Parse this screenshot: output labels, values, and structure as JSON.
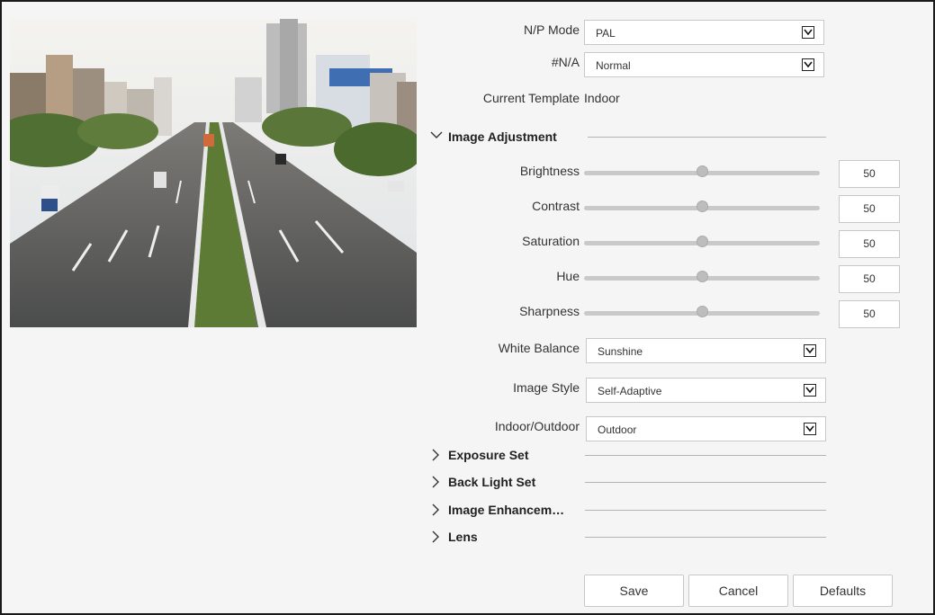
{
  "np_mode": {
    "label": "N/P Mode",
    "value": "PAL"
  },
  "na_mode": {
    "label": "#N/A",
    "value": "Normal"
  },
  "current_template": {
    "label": "Current Template",
    "value": "Indoor"
  },
  "sections": {
    "image_adjustment": "Image Adjustment",
    "exposure_set": "Exposure Set",
    "back_light_set": "Back Light Set",
    "image_enhancement": "Image Enhancem…",
    "lens": "Lens"
  },
  "sliders": [
    {
      "label": "Brightness",
      "value": "50",
      "level": 50
    },
    {
      "label": "Contrast",
      "value": "50",
      "level": 50
    },
    {
      "label": "Saturation",
      "value": "50",
      "level": 50
    },
    {
      "label": "Hue",
      "value": "50",
      "level": 50
    },
    {
      "label": "Sharpness",
      "value": "50",
      "level": 50
    }
  ],
  "white_balance": {
    "label": "White Balance",
    "value": "Sunshine"
  },
  "image_style": {
    "label": "Image Style",
    "value": "Self-Adaptive"
  },
  "indoor_outdoor": {
    "label": "Indoor/Outdoor",
    "value": "Outdoor"
  },
  "buttons": {
    "save": "Save",
    "cancel": "Cancel",
    "defaults": "Defaults"
  },
  "icons": {
    "dropdown": "chevron-down-icon",
    "expanded": "chevron-down-icon",
    "collapsed": "chevron-right-icon"
  }
}
